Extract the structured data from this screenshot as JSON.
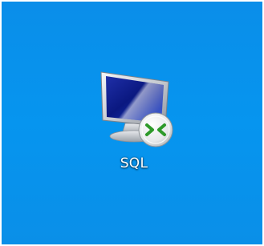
{
  "desktop": {
    "background_color": "#0894ed",
    "icons": [
      {
        "label": "SQL",
        "icon": "remote-desktop-connection-icon"
      }
    ]
  }
}
